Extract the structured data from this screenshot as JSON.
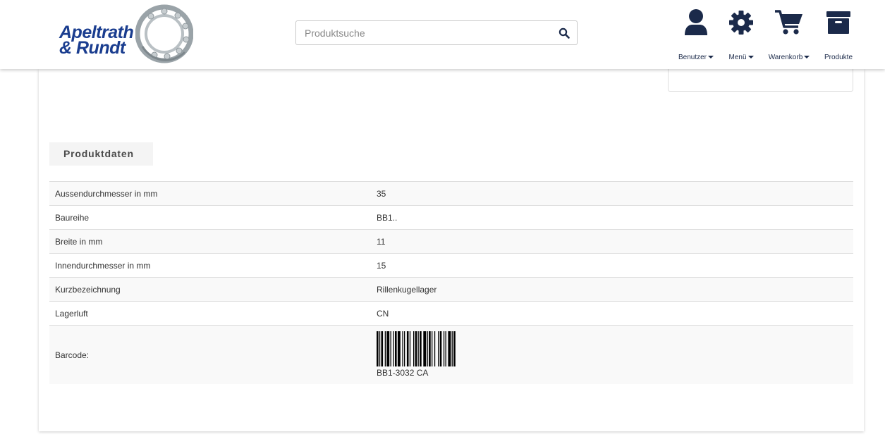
{
  "brand": {
    "line1": "Apeltrath",
    "line2": "& Rundt",
    "primary_color": "#1a3d8f",
    "nav_color": "#1b2a4a"
  },
  "search": {
    "placeholder": "Produktsuche",
    "icon": "search-icon"
  },
  "nav": {
    "user": {
      "label": "Benutzer",
      "icon": "user-icon"
    },
    "menu": {
      "label": "Menü",
      "icon": "gear-icon"
    },
    "cart": {
      "label": "Warenkorb",
      "icon": "cart-icon"
    },
    "products": {
      "label": "Produkte",
      "icon": "archive-box-icon"
    }
  },
  "tab": {
    "label": "Produktdaten"
  },
  "table": {
    "rows": [
      {
        "key": "Aussendurchmesser in mm",
        "value": "35"
      },
      {
        "key": "Baureihe",
        "value": "BB1.."
      },
      {
        "key": "Breite in mm",
        "value": "11"
      },
      {
        "key": "Innendurchmesser in mm",
        "value": "15"
      },
      {
        "key": "Kurzbezeichnung",
        "value": "Rillenkugellager"
      },
      {
        "key": "Lagerluft",
        "value": "CN"
      }
    ],
    "barcode": {
      "key": "Barcode:",
      "value": "BB1-3032 CA"
    }
  }
}
